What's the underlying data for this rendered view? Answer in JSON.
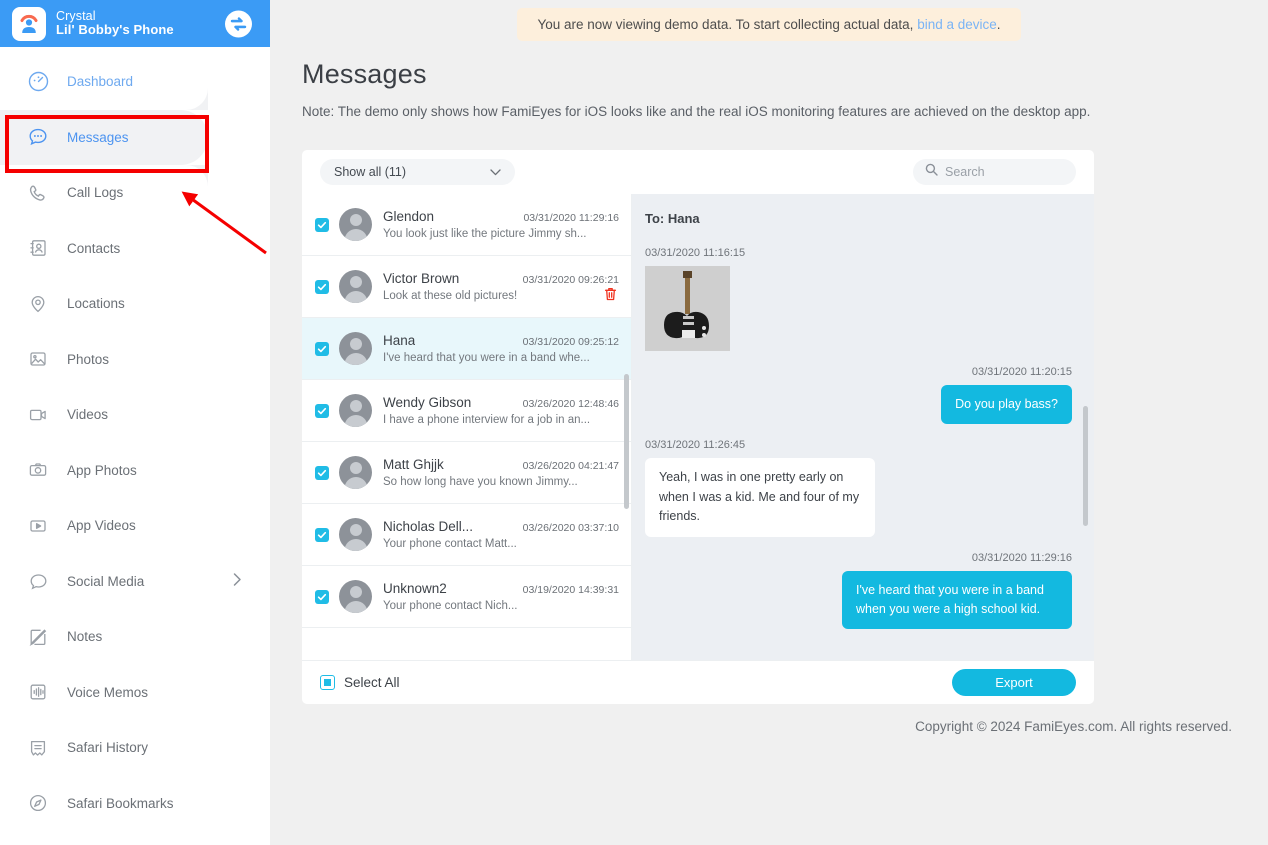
{
  "sidebar": {
    "device_owner": "Crystal",
    "device_name": "Lil' Bobby's Phone",
    "switch_icon": "switch-device-icon",
    "items": [
      {
        "label": "Dashboard",
        "icon": "dashboard-icon"
      },
      {
        "label": "Messages",
        "icon": "messages-icon"
      },
      {
        "label": "Call Logs",
        "icon": "phone-icon"
      },
      {
        "label": "Contacts",
        "icon": "contacts-icon"
      },
      {
        "label": "Locations",
        "icon": "location-pin-icon"
      },
      {
        "label": "Photos",
        "icon": "photo-icon"
      },
      {
        "label": "Videos",
        "icon": "video-icon"
      },
      {
        "label": "App Photos",
        "icon": "camera-icon"
      },
      {
        "label": "App Videos",
        "icon": "play-box-icon"
      },
      {
        "label": "Social Media",
        "icon": "chat-bubble-icon"
      },
      {
        "label": "Notes",
        "icon": "note-pencil-icon"
      },
      {
        "label": "Voice Memos",
        "icon": "waveform-icon"
      },
      {
        "label": "Safari History",
        "icon": "bookmark-ribbon-icon"
      },
      {
        "label": "Safari Bookmarks",
        "icon": "compass-icon"
      }
    ]
  },
  "banner": {
    "text_before": "You are now viewing demo data. To start collecting actual data,",
    "link": "bind a device",
    "text_after": "."
  },
  "page": {
    "title": "Messages",
    "note": "Note: The demo only shows how FamiEyes for iOS looks like and the real iOS monitoring features are achieved on the desktop app."
  },
  "toolbar": {
    "filter_label": "Show all (11)",
    "filter_icon": "chevron-down-icon",
    "search_icon": "search-icon",
    "search_value": "",
    "search_placeholder": "Search"
  },
  "conversations": [
    {
      "name": "Glendon",
      "date": "03/31/2020",
      "time": "11:29:16",
      "snippet": "You look just like the picture Jimmy sh...",
      "checked": true,
      "selected": false,
      "has_delete": false
    },
    {
      "name": "Victor Brown",
      "date": "03/31/2020",
      "time": "09:26:21",
      "snippet": "Look at these old pictures!",
      "checked": true,
      "selected": false,
      "has_delete": true
    },
    {
      "name": "Hana",
      "date": "03/31/2020",
      "time": "09:25:12",
      "snippet": "I've heard that you were in a band whe...",
      "checked": true,
      "selected": true,
      "has_delete": false
    },
    {
      "name": "Wendy Gibson",
      "date": "03/26/2020",
      "time": "12:48:46",
      "snippet": "I have a phone interview for a job in an...",
      "checked": true,
      "selected": false,
      "has_delete": false
    },
    {
      "name": "Matt Ghjjk",
      "date": "03/26/2020",
      "time": "04:21:47",
      "snippet": "So how long have you known Jimmy...",
      "checked": true,
      "selected": false,
      "has_delete": false
    },
    {
      "name": "Nicholas Dell...",
      "date": "03/26/2020",
      "time": "03:37:10",
      "snippet": "Your phone contact Matt...",
      "checked": true,
      "selected": false,
      "has_delete": false
    },
    {
      "name": "Unknown2",
      "date": "03/19/2020",
      "time": "14:39:31",
      "snippet": "Your phone contact Nich...",
      "checked": true,
      "selected": false,
      "has_delete": false
    }
  ],
  "detail": {
    "to_label": "To: Hana",
    "messages": [
      {
        "dir": "in",
        "date": "03/31/2020",
        "time": "11:16:15",
        "type": "image",
        "text": ""
      },
      {
        "dir": "out",
        "date": "03/31/2020",
        "time": "11:20:15",
        "type": "text",
        "text": "Do you play bass?"
      },
      {
        "dir": "in",
        "date": "03/31/2020",
        "time": "11:26:45",
        "type": "text",
        "text": "Yeah, I was in one pretty early on when I was a kid. Me and four of my friends."
      },
      {
        "dir": "out",
        "date": "03/31/2020",
        "time": "11:29:16",
        "type": "text",
        "text": "I've heard that you were in a band when you were a high school kid."
      }
    ]
  },
  "footer": {
    "select_all_label": "Select All",
    "export_label": "Export"
  },
  "copyright": "Copyright © 2024 FamiEyes.com. All rights reserved.",
  "colors": {
    "header_blue": "#3b9bf5",
    "accent_cyan": "#13b9e0",
    "checkbox_cyan": "#20bce6",
    "banner_bg": "#fdefdc",
    "annotation_red": "#f50000"
  }
}
